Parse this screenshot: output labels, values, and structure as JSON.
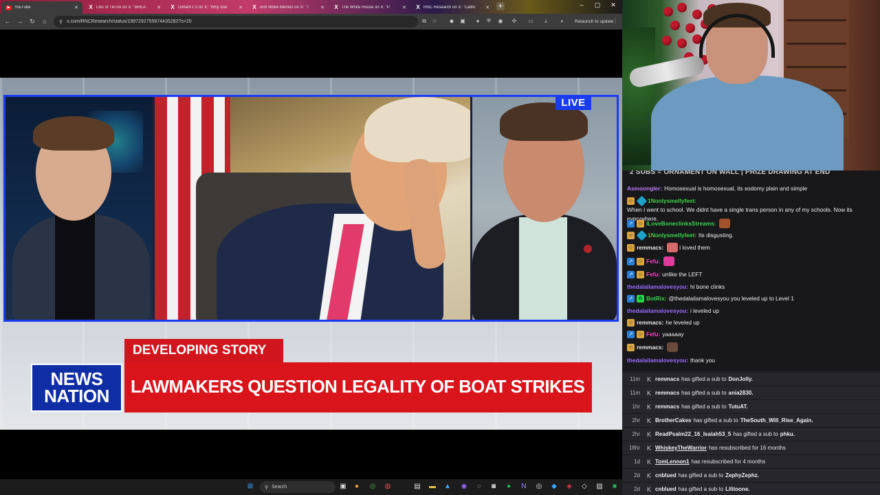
{
  "browser": {
    "tabs": [
      {
        "icon": "youtube-icon",
        "title": "YouTube",
        "active": true
      },
      {
        "icon": "x-logo-icon",
        "title": "Libs of TikTok on X: \"BREA"
      },
      {
        "icon": "x-logo-icon",
        "title": "Defiant L's on X: \"Why doe"
      },
      {
        "icon": "x-logo-icon",
        "title": "Anti Woke Memes on X: \"T"
      },
      {
        "icon": "x-logo-icon",
        "title": "The White House on X: \"P"
      },
      {
        "icon": "x-logo-icon",
        "title": "RNC Research on X: \"Califo"
      }
    ],
    "url": "x.com/RNCResearch/status/1997292755874435282?s=20",
    "relaunch_label": "Relaunch to update"
  },
  "video": {
    "live_label": "LIVE",
    "developing_label": "DEVELOPING STORY",
    "headline": "LAWMAKERS QUESTION LEGALITY OF BOAT STRIKES",
    "logo_line1": "NEWS",
    "logo_line2": "NATION"
  },
  "taskbar": {
    "search_placeholder": "Search"
  },
  "chat": {
    "banner": "2 SUBS = ORNAMENT ON WALL | PRIZE DRAWING AT END",
    "messages": [
      {
        "badges": [],
        "user": "Asmoongler:",
        "color": "#b57cf0",
        "text": "Homosexual is homosexual, its sodomy plain and simple"
      },
      {
        "badges": [
          "sub",
          "gem"
        ],
        "user": "1Nonlysmellyfeet:",
        "color": "#3bd44a",
        "text": "When I went to school. We didnt have a single trans person in any of my schools. Now its everywhere."
      },
      {
        "badges": [
          "prime",
          "sub"
        ],
        "user": "ILoveBoneclinksStreams:",
        "color": "#3bd44a",
        "text": "",
        "emote": "#a0522d"
      },
      {
        "badges": [
          "sub",
          "gem"
        ],
        "user": "1Nonlysmellyfeet:",
        "color": "#3bd44a",
        "text": "Its disgusting."
      },
      {
        "badges": [
          "sub"
        ],
        "user": "remmacs:",
        "color": "#e8e8e8",
        "text": "i loved them",
        "emote": "#d46a6a"
      },
      {
        "badges": [
          "prime",
          "sub"
        ],
        "user": "Fefu:",
        "color": "#ff3ec8",
        "text": "",
        "emote": "#e03a9a"
      },
      {
        "badges": [
          "prime",
          "sub"
        ],
        "user": "Fefu:",
        "color": "#ff3ec8",
        "text": "unlike the LEFT"
      },
      {
        "badges": [],
        "user": "thedalailamalovesyou:",
        "color": "#9b6bff",
        "text": "hi bone clinks"
      },
      {
        "badges": [
          "prime",
          "bot"
        ],
        "user": "BotRix:",
        "color": "#3bd44a",
        "text": "@thedalailamalovesyou you leveled up to Level 1"
      },
      {
        "badges": [],
        "user": "thedalailamalovesyou:",
        "color": "#9b6bff",
        "text": "i leveled up"
      },
      {
        "badges": [
          "sub"
        ],
        "user": "remmacs:",
        "color": "#e8e8e8",
        "text": "he leveled up"
      },
      {
        "badges": [
          "prime",
          "sub"
        ],
        "user": "Fefu:",
        "color": "#ff3ec8",
        "text": "yaaaaay"
      },
      {
        "badges": [
          "sub"
        ],
        "user": "remmacs:",
        "color": "#e8e8e8",
        "text": "",
        "emote": "#6a4a3a"
      },
      {
        "badges": [],
        "user": "thedalailamalovesyou:",
        "color": "#9b6bff",
        "text": "thank you"
      }
    ]
  },
  "events": [
    {
      "time": "11m",
      "user": "remmacs",
      "action": "has gifted a sub to",
      "target": "DonJolly.",
      "underline": false
    },
    {
      "time": "11m",
      "user": "remmacs",
      "action": "has gifted a sub to",
      "target": "ania2830.",
      "underline": false
    },
    {
      "time": "1hr",
      "user": "remmacs",
      "action": "has gifted a sub to",
      "target": "TutuAT.",
      "underline": false
    },
    {
      "time": "2hr",
      "user": "BrotherCakes",
      "action": "has gifted a sub to",
      "target": "TheSouth_Will_Rise_Again.",
      "underline": false
    },
    {
      "time": "2hr",
      "user": "ReadPsalm22_16_Isaiah53_5",
      "action": "has gifted a sub to",
      "target": "phku.",
      "underline": false
    },
    {
      "time": "18hr",
      "user": "WhiskeyTheWarrior",
      "action": "has resubscribed for 16 months",
      "target": "",
      "underline": true
    },
    {
      "time": "1d",
      "user": "TomLennon1",
      "action": "has resubscribed for 4 months",
      "target": "",
      "underline": true
    },
    {
      "time": "2d",
      "user": "cnblued",
      "action": "has gifted a sub to",
      "target": "ZephyZephz.",
      "underline": false
    },
    {
      "time": "2d",
      "user": "cnblued",
      "action": "has gifted a sub to",
      "target": "Lilitoone.",
      "underline": false
    }
  ]
}
